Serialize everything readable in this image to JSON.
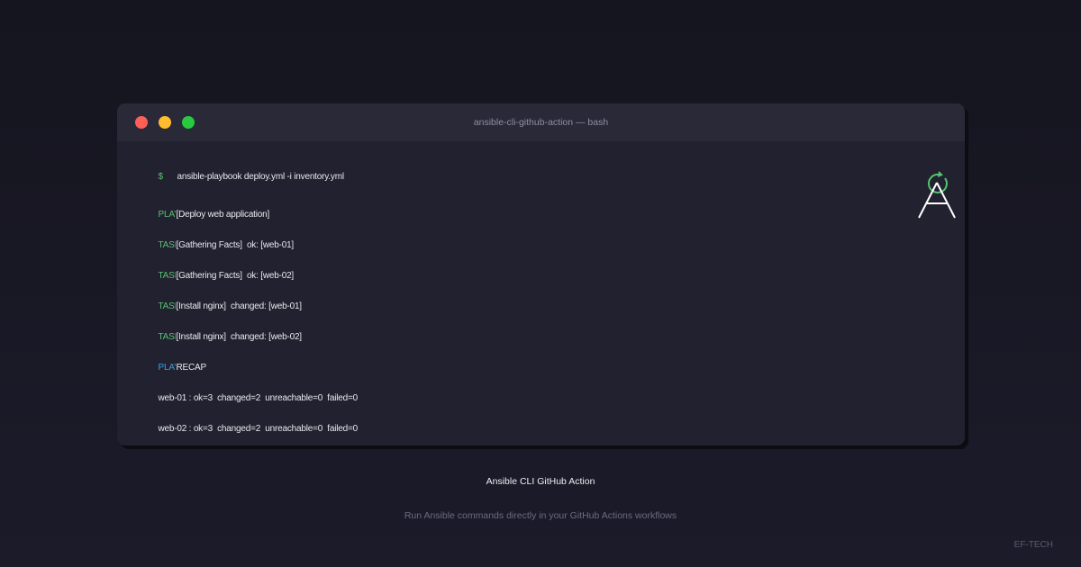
{
  "window": {
    "title": "ansible-cli-github-action — bash"
  },
  "terminal": {
    "prompt": "$",
    "command": "ansible-playbook deploy.yml -i inventory.yml",
    "lines": [
      {
        "keyword": "PLAY",
        "keyword_color": "green",
        "text": "[Deploy web application]"
      },
      {
        "keyword": "TASK",
        "keyword_color": "green",
        "text": "[Gathering Facts]  ok: [web-01]"
      },
      {
        "keyword": "TASK",
        "keyword_color": "green",
        "text": "[Gathering Facts]  ok: [web-02]"
      },
      {
        "keyword": "TASK",
        "keyword_color": "green",
        "text": "[Install nginx]  changed: [web-01]"
      },
      {
        "keyword": "TASK",
        "keyword_color": "green",
        "text": "[Install nginx]  changed: [web-02]"
      },
      {
        "keyword": "PLAY",
        "keyword_color": "blue",
        "text": "RECAP"
      },
      {
        "keyword": "",
        "keyword_color": "",
        "text": "web-01 : ok=3  changed=2  unreachable=0  failed=0"
      },
      {
        "keyword": "",
        "keyword_color": "",
        "text": "web-02 : ok=3  changed=2  unreachable=0  failed=0"
      }
    ]
  },
  "logo": {
    "icon": "ansible-sync-icon",
    "color": "#56c271"
  },
  "footer": {
    "title": "Ansible CLI GitHub Action",
    "subtitle": "Run Ansible commands directly in your GitHub Actions workflows",
    "brand": "EF-TECH"
  },
  "colors": {
    "background": "#1a1a26",
    "window": "#22212f",
    "titlebar": "#2a2938",
    "accent_green": "#56c271",
    "accent_blue": "#3a9ee0"
  }
}
